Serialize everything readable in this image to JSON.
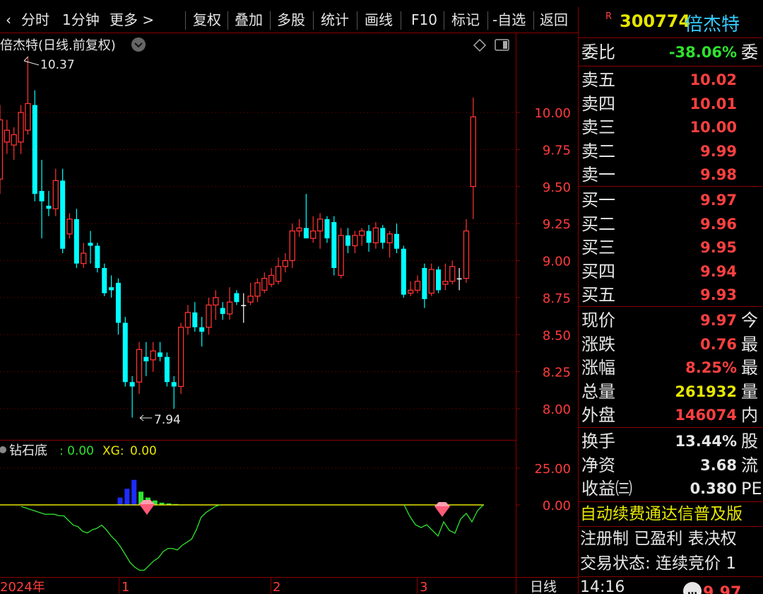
{
  "toolbar": {
    "items": [
      "分时",
      "1分钟",
      "更多 >",
      "复权",
      "叠加",
      "多股",
      "统计",
      "画线",
      "F10",
      "标记",
      "-自选",
      "返回"
    ]
  },
  "chart": {
    "title": "倍杰特(日线.前复权)",
    "high_label": "10.37",
    "low_label": "7.94",
    "price_axis": [
      "10.00",
      "9.75",
      "9.50",
      "9.25",
      "9.00",
      "8.75",
      "8.50",
      "8.25",
      "8.00"
    ],
    "indicator_name": "钻石底",
    "indicator_val1": ": 0.00",
    "indicator_key2": "XG:",
    "indicator_val2": "0.00",
    "indicator_axis": [
      "25.00",
      "0.00"
    ],
    "time_axis": [
      "2024年",
      "1",
      "2",
      "3"
    ],
    "period_label": "日线",
    "colors": {
      "up": "#ff3232",
      "down": "#00ffff",
      "grid": "#8a0000",
      "axis_text": "#ff3c3c"
    }
  },
  "chart_data": {
    "type": "candlestick",
    "candles": [
      {
        "o": 9.55,
        "h": 10.05,
        "l": 9.45,
        "c": 9.95
      },
      {
        "o": 9.8,
        "h": 9.95,
        "l": 9.72,
        "c": 9.88
      },
      {
        "o": 9.78,
        "h": 9.9,
        "l": 9.68,
        "c": 9.85
      },
      {
        "o": 9.8,
        "h": 10.05,
        "l": 9.72,
        "c": 10.0
      },
      {
        "o": 9.88,
        "h": 10.37,
        "l": 9.85,
        "c": 10.06
      },
      {
        "o": 10.05,
        "h": 10.15,
        "l": 9.4,
        "c": 9.45
      },
      {
        "o": 9.47,
        "h": 9.68,
        "l": 9.15,
        "c": 9.4
      },
      {
        "o": 9.37,
        "h": 9.47,
        "l": 9.3,
        "c": 9.35
      },
      {
        "o": 9.35,
        "h": 9.62,
        "l": 9.3,
        "c": 9.54
      },
      {
        "o": 9.54,
        "h": 9.62,
        "l": 9.05,
        "c": 9.08
      },
      {
        "o": 9.18,
        "h": 9.32,
        "l": 9.15,
        "c": 9.28
      },
      {
        "o": 9.28,
        "h": 9.35,
        "l": 8.95,
        "c": 8.98
      },
      {
        "o": 8.98,
        "h": 9.12,
        "l": 8.95,
        "c": 9.05
      },
      {
        "o": 9.12,
        "h": 9.2,
        "l": 8.98,
        "c": 9.1
      },
      {
        "o": 9.1,
        "h": 9.12,
        "l": 8.92,
        "c": 8.95
      },
      {
        "o": 8.95,
        "h": 8.98,
        "l": 8.76,
        "c": 8.78
      },
      {
        "o": 8.82,
        "h": 8.9,
        "l": 8.75,
        "c": 8.8
      },
      {
        "o": 8.85,
        "h": 8.88,
        "l": 8.5,
        "c": 8.58
      },
      {
        "o": 8.58,
        "h": 8.62,
        "l": 8.15,
        "c": 8.18
      },
      {
        "o": 8.18,
        "h": 8.22,
        "l": 7.94,
        "c": 8.15
      },
      {
        "o": 8.18,
        "h": 8.45,
        "l": 8.1,
        "c": 8.4
      },
      {
        "o": 8.35,
        "h": 8.45,
        "l": 8.22,
        "c": 8.32
      },
      {
        "o": 8.33,
        "h": 8.45,
        "l": 8.25,
        "c": 8.39
      },
      {
        "o": 8.38,
        "h": 8.45,
        "l": 8.32,
        "c": 8.35
      },
      {
        "o": 8.35,
        "h": 8.38,
        "l": 8.15,
        "c": 8.18
      },
      {
        "o": 8.18,
        "h": 8.22,
        "l": 8.0,
        "c": 8.15
      },
      {
        "o": 8.15,
        "h": 8.58,
        "l": 8.1,
        "c": 8.55
      },
      {
        "o": 8.55,
        "h": 8.7,
        "l": 8.5,
        "c": 8.65
      },
      {
        "o": 8.65,
        "h": 8.72,
        "l": 8.52,
        "c": 8.55
      },
      {
        "o": 8.55,
        "h": 8.62,
        "l": 8.42,
        "c": 8.52
      },
      {
        "o": 8.55,
        "h": 8.75,
        "l": 8.5,
        "c": 8.7
      },
      {
        "o": 8.7,
        "h": 8.8,
        "l": 8.6,
        "c": 8.75
      },
      {
        "o": 8.68,
        "h": 8.72,
        "l": 8.6,
        "c": 8.64
      },
      {
        "o": 8.64,
        "h": 8.82,
        "l": 8.6,
        "c": 8.72
      },
      {
        "o": 8.78,
        "h": 8.8,
        "l": 8.7,
        "c": 8.72
      },
      {
        "o": 8.7,
        "h": 8.78,
        "l": 8.58,
        "c": 8.7
      },
      {
        "o": 8.72,
        "h": 8.85,
        "l": 8.7,
        "c": 8.76
      },
      {
        "o": 8.76,
        "h": 8.88,
        "l": 8.72,
        "c": 8.85
      },
      {
        "o": 8.8,
        "h": 8.92,
        "l": 8.78,
        "c": 8.88
      },
      {
        "o": 8.84,
        "h": 8.95,
        "l": 8.82,
        "c": 8.9
      },
      {
        "o": 8.86,
        "h": 9.02,
        "l": 8.84,
        "c": 8.96
      },
      {
        "o": 8.96,
        "h": 9.05,
        "l": 8.92,
        "c": 9.0
      },
      {
        "o": 9.0,
        "h": 9.25,
        "l": 8.95,
        "c": 9.2
      },
      {
        "o": 9.2,
        "h": 9.28,
        "l": 9.16,
        "c": 9.22
      },
      {
        "o": 9.22,
        "h": 9.45,
        "l": 9.18,
        "c": 9.15
      },
      {
        "o": 9.15,
        "h": 9.3,
        "l": 9.12,
        "c": 9.2
      },
      {
        "o": 9.2,
        "h": 9.32,
        "l": 9.08,
        "c": 9.28
      },
      {
        "o": 9.28,
        "h": 9.3,
        "l": 9.12,
        "c": 9.15
      },
      {
        "o": 9.26,
        "h": 9.3,
        "l": 8.9,
        "c": 8.95
      },
      {
        "o": 8.9,
        "h": 9.22,
        "l": 8.88,
        "c": 9.17
      },
      {
        "o": 9.17,
        "h": 9.22,
        "l": 9.05,
        "c": 9.1
      },
      {
        "o": 9.1,
        "h": 9.2,
        "l": 9.05,
        "c": 9.17
      },
      {
        "o": 9.17,
        "h": 9.22,
        "l": 9.1,
        "c": 9.2
      },
      {
        "o": 9.2,
        "h": 9.24,
        "l": 9.06,
        "c": 9.12
      },
      {
        "o": 9.12,
        "h": 9.26,
        "l": 9.08,
        "c": 9.22
      },
      {
        "o": 9.22,
        "h": 9.24,
        "l": 9.08,
        "c": 9.12
      },
      {
        "o": 9.12,
        "h": 9.2,
        "l": 9.02,
        "c": 9.18
      },
      {
        "o": 9.18,
        "h": 9.25,
        "l": 9.05,
        "c": 9.08
      },
      {
        "o": 9.08,
        "h": 9.1,
        "l": 8.75,
        "c": 8.77
      },
      {
        "o": 8.78,
        "h": 8.86,
        "l": 8.76,
        "c": 8.8
      },
      {
        "o": 8.8,
        "h": 8.9,
        "l": 8.78,
        "c": 8.86
      },
      {
        "o": 8.95,
        "h": 8.98,
        "l": 8.68,
        "c": 8.74
      },
      {
        "o": 8.78,
        "h": 8.98,
        "l": 8.76,
        "c": 8.94
      },
      {
        "o": 8.94,
        "h": 8.96,
        "l": 8.78,
        "c": 8.8
      },
      {
        "o": 8.84,
        "h": 8.98,
        "l": 8.8,
        "c": 8.86
      },
      {
        "o": 8.86,
        "h": 9.0,
        "l": 8.84,
        "c": 8.96
      },
      {
        "o": 8.88,
        "h": 8.95,
        "l": 8.8,
        "c": 8.88
      },
      {
        "o": 8.88,
        "h": 9.28,
        "l": 8.85,
        "c": 9.2
      },
      {
        "o": 9.5,
        "h": 10.1,
        "l": 9.28,
        "c": 9.97
      }
    ],
    "indicator_bars": [
      {
        "i": 24,
        "v": 5,
        "color": "blue"
      },
      {
        "i": 25,
        "v": 11,
        "color": "blue"
      },
      {
        "i": 26,
        "v": 17,
        "color": "blue"
      },
      {
        "i": 27,
        "v": 9,
        "color": "green"
      },
      {
        "i": 28,
        "v": 5,
        "color": "green"
      },
      {
        "i": 29,
        "v": 3,
        "color": "green"
      },
      {
        "i": 30,
        "v": 1.5,
        "color": "green"
      },
      {
        "i": 31,
        "v": 1,
        "color": "green"
      },
      {
        "i": 32,
        "v": 0.6,
        "color": "green"
      }
    ],
    "indicator_line": [
      -1,
      -2,
      -3,
      -4,
      -5,
      -6,
      -6,
      -6,
      -7,
      -7,
      -10,
      -13,
      -14,
      -17,
      -18,
      -16,
      -15,
      -13,
      -16,
      -20,
      -23,
      -27,
      -32,
      -37,
      -40,
      -42,
      -42,
      -39,
      -36,
      -34,
      -30,
      -28,
      -28,
      -29,
      -26,
      -24,
      -22,
      -16,
      -8,
      -5,
      -3,
      -1,
      0
    ],
    "ylim": [
      7.75,
      10.55
    ],
    "indicator_ylim": [
      -45,
      35
    ]
  },
  "quote": {
    "flag": "R",
    "code": "300774",
    "name": "倍杰特",
    "ratio_label": "委比",
    "ratio_value": "-38.06%",
    "ratio_extra": "委",
    "asks": [
      {
        "label": "卖五",
        "price": "10.02"
      },
      {
        "label": "卖四",
        "price": "10.01"
      },
      {
        "label": "卖三",
        "price": "10.00"
      },
      {
        "label": "卖二",
        "price": "9.99"
      },
      {
        "label": "卖一",
        "price": "9.98"
      }
    ],
    "bids": [
      {
        "label": "买一",
        "price": "9.97"
      },
      {
        "label": "买二",
        "price": "9.96"
      },
      {
        "label": "买三",
        "price": "9.95"
      },
      {
        "label": "买四",
        "price": "9.94"
      },
      {
        "label": "买五",
        "price": "9.93"
      }
    ],
    "stats": [
      {
        "label": "现价",
        "value": "9.97",
        "extra": "今",
        "color": "red"
      },
      {
        "label": "涨跌",
        "value": "0.76",
        "extra": "最",
        "color": "red"
      },
      {
        "label": "涨幅",
        "value": "8.25%",
        "extra": "最",
        "color": "red"
      },
      {
        "label": "总量",
        "value": "261932",
        "extra": "量",
        "color": "yellow"
      },
      {
        "label": "外盘",
        "value": "146074",
        "extra": "内",
        "color": "red"
      }
    ],
    "fin": [
      {
        "label": "换手",
        "value": "13.44%",
        "extra": "股"
      },
      {
        "label": "净资",
        "value": "3.68",
        "extra": "流"
      },
      {
        "label": "收益㈢",
        "value": "0.380",
        "extra": "PE"
      }
    ],
    "ticker": "自动续费通达信普及版",
    "tags": "注册制 已盈利 表决权",
    "status": "交易状态: 连续竞价 1",
    "time": "14:16",
    "last_price": "9.97"
  }
}
